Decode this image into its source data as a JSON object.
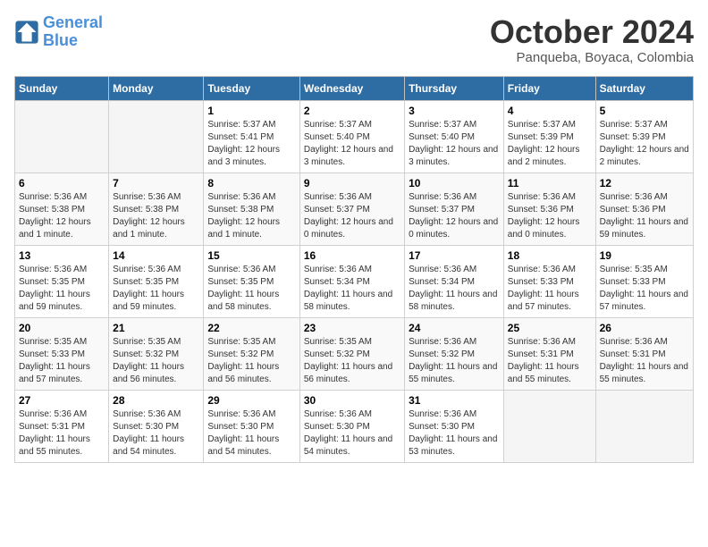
{
  "logo": {
    "line1": "General",
    "line2": "Blue"
  },
  "title": "October 2024",
  "subtitle": "Panqueba, Boyaca, Colombia",
  "days_of_week": [
    "Sunday",
    "Monday",
    "Tuesday",
    "Wednesday",
    "Thursday",
    "Friday",
    "Saturday"
  ],
  "weeks": [
    [
      {
        "day": "",
        "info": ""
      },
      {
        "day": "",
        "info": ""
      },
      {
        "day": "1",
        "info": "Sunrise: 5:37 AM\nSunset: 5:41 PM\nDaylight: 12 hours and 3 minutes."
      },
      {
        "day": "2",
        "info": "Sunrise: 5:37 AM\nSunset: 5:40 PM\nDaylight: 12 hours and 3 minutes."
      },
      {
        "day": "3",
        "info": "Sunrise: 5:37 AM\nSunset: 5:40 PM\nDaylight: 12 hours and 3 minutes."
      },
      {
        "day": "4",
        "info": "Sunrise: 5:37 AM\nSunset: 5:39 PM\nDaylight: 12 hours and 2 minutes."
      },
      {
        "day": "5",
        "info": "Sunrise: 5:37 AM\nSunset: 5:39 PM\nDaylight: 12 hours and 2 minutes."
      }
    ],
    [
      {
        "day": "6",
        "info": "Sunrise: 5:36 AM\nSunset: 5:38 PM\nDaylight: 12 hours and 1 minute."
      },
      {
        "day": "7",
        "info": "Sunrise: 5:36 AM\nSunset: 5:38 PM\nDaylight: 12 hours and 1 minute."
      },
      {
        "day": "8",
        "info": "Sunrise: 5:36 AM\nSunset: 5:38 PM\nDaylight: 12 hours and 1 minute."
      },
      {
        "day": "9",
        "info": "Sunrise: 5:36 AM\nSunset: 5:37 PM\nDaylight: 12 hours and 0 minutes."
      },
      {
        "day": "10",
        "info": "Sunrise: 5:36 AM\nSunset: 5:37 PM\nDaylight: 12 hours and 0 minutes."
      },
      {
        "day": "11",
        "info": "Sunrise: 5:36 AM\nSunset: 5:36 PM\nDaylight: 12 hours and 0 minutes."
      },
      {
        "day": "12",
        "info": "Sunrise: 5:36 AM\nSunset: 5:36 PM\nDaylight: 11 hours and 59 minutes."
      }
    ],
    [
      {
        "day": "13",
        "info": "Sunrise: 5:36 AM\nSunset: 5:35 PM\nDaylight: 11 hours and 59 minutes."
      },
      {
        "day": "14",
        "info": "Sunrise: 5:36 AM\nSunset: 5:35 PM\nDaylight: 11 hours and 59 minutes."
      },
      {
        "day": "15",
        "info": "Sunrise: 5:36 AM\nSunset: 5:35 PM\nDaylight: 11 hours and 58 minutes."
      },
      {
        "day": "16",
        "info": "Sunrise: 5:36 AM\nSunset: 5:34 PM\nDaylight: 11 hours and 58 minutes."
      },
      {
        "day": "17",
        "info": "Sunrise: 5:36 AM\nSunset: 5:34 PM\nDaylight: 11 hours and 58 minutes."
      },
      {
        "day": "18",
        "info": "Sunrise: 5:36 AM\nSunset: 5:33 PM\nDaylight: 11 hours and 57 minutes."
      },
      {
        "day": "19",
        "info": "Sunrise: 5:35 AM\nSunset: 5:33 PM\nDaylight: 11 hours and 57 minutes."
      }
    ],
    [
      {
        "day": "20",
        "info": "Sunrise: 5:35 AM\nSunset: 5:33 PM\nDaylight: 11 hours and 57 minutes."
      },
      {
        "day": "21",
        "info": "Sunrise: 5:35 AM\nSunset: 5:32 PM\nDaylight: 11 hours and 56 minutes."
      },
      {
        "day": "22",
        "info": "Sunrise: 5:35 AM\nSunset: 5:32 PM\nDaylight: 11 hours and 56 minutes."
      },
      {
        "day": "23",
        "info": "Sunrise: 5:35 AM\nSunset: 5:32 PM\nDaylight: 11 hours and 56 minutes."
      },
      {
        "day": "24",
        "info": "Sunrise: 5:36 AM\nSunset: 5:32 PM\nDaylight: 11 hours and 55 minutes."
      },
      {
        "day": "25",
        "info": "Sunrise: 5:36 AM\nSunset: 5:31 PM\nDaylight: 11 hours and 55 minutes."
      },
      {
        "day": "26",
        "info": "Sunrise: 5:36 AM\nSunset: 5:31 PM\nDaylight: 11 hours and 55 minutes."
      }
    ],
    [
      {
        "day": "27",
        "info": "Sunrise: 5:36 AM\nSunset: 5:31 PM\nDaylight: 11 hours and 55 minutes."
      },
      {
        "day": "28",
        "info": "Sunrise: 5:36 AM\nSunset: 5:30 PM\nDaylight: 11 hours and 54 minutes."
      },
      {
        "day": "29",
        "info": "Sunrise: 5:36 AM\nSunset: 5:30 PM\nDaylight: 11 hours and 54 minutes."
      },
      {
        "day": "30",
        "info": "Sunrise: 5:36 AM\nSunset: 5:30 PM\nDaylight: 11 hours and 54 minutes."
      },
      {
        "day": "31",
        "info": "Sunrise: 5:36 AM\nSunset: 5:30 PM\nDaylight: 11 hours and 53 minutes."
      },
      {
        "day": "",
        "info": ""
      },
      {
        "day": "",
        "info": ""
      }
    ]
  ]
}
